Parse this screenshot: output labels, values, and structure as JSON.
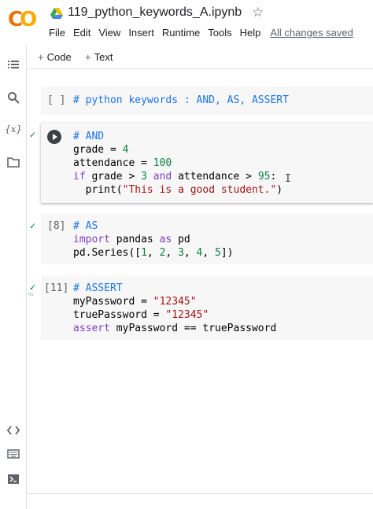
{
  "header": {
    "logo_text_1": "C",
    "logo_text_2": "O",
    "notebook_title": "119_python_keywords_A.ipynb",
    "star_glyph": "☆",
    "menu": [
      "File",
      "Edit",
      "View",
      "Insert",
      "Runtime",
      "Tools",
      "Help"
    ],
    "save_status": "All changes saved"
  },
  "rail": {
    "icons": [
      "list-icon",
      "search-icon",
      "variables-icon",
      "folder-icon",
      "code-snippets-icon",
      "command-palette-icon",
      "terminal-icon"
    ],
    "variables_glyph": "{x}"
  },
  "toolbar": {
    "add_code_label": "Code",
    "add_text_label": "Text",
    "plus_glyph": "+"
  },
  "cells": [
    {
      "exec": "[ ]",
      "lines": [
        "# python keywords : AND, AS, ASSERT"
      ]
    },
    {
      "exec": "",
      "lines": [
        "# AND",
        "grade = 4",
        "attendance = 100",
        "if grade > 3 and attendance > 95:",
        "  print(\"This is a good student.\")"
      ]
    },
    {
      "exec": "[8]",
      "lines": [
        "# AS",
        "import pandas as pd",
        "pd.Series([1, 2, 3, 4, 5])"
      ]
    },
    {
      "exec": "[11]",
      "lines": [
        "# ASSERT",
        "myPassword = \"12345\"",
        "truePassword = \"12345\"",
        "assert myPassword == truePassword"
      ]
    }
  ],
  "cell_status": {
    "check_glyph": "✓",
    "time_label": "0s"
  },
  "colors": {
    "comment": "#1a73e8",
    "keyword": "#7c3fbf",
    "string": "#a31515",
    "number": "#0b8043",
    "success": "#0b8043"
  }
}
